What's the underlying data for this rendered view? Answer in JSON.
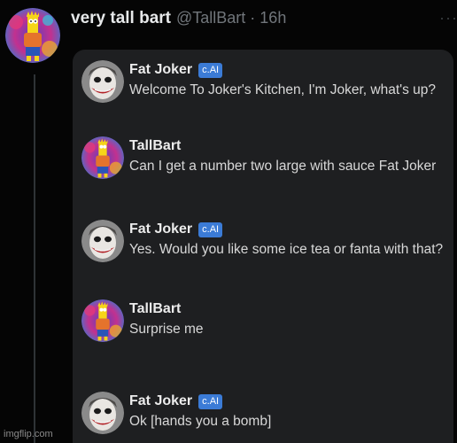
{
  "tweet": {
    "display_name": "very tall bart",
    "handle": "@TallBart",
    "separator": "·",
    "time": "16h",
    "more_icon": "···"
  },
  "messages": [
    {
      "sender": "Fat Joker",
      "badge": "c.AI",
      "avatar": "joker-icon",
      "text": "Welcome To Joker's Kitchen, I'm Joker, what's up?"
    },
    {
      "sender": "TallBart",
      "avatar": "bart-icon",
      "text": "Can I get a number two large with sauce Fat Joker"
    },
    {
      "sender": "Fat Joker",
      "badge": "c.AI",
      "avatar": "joker-icon",
      "text": "Yes. Would you like some ice tea or fanta with that?"
    },
    {
      "sender": "TallBart",
      "avatar": "bart-icon",
      "text": "Surprise me"
    },
    {
      "sender": "Fat Joker",
      "badge": "c.AI",
      "avatar": "joker-icon",
      "text": "Ok [hands you a bomb]"
    }
  ],
  "watermark": "imgflip.com",
  "colors": {
    "background": "#000000",
    "card": "#1e1f21",
    "badge": "#3b7bd6",
    "muted": "#71767b"
  }
}
